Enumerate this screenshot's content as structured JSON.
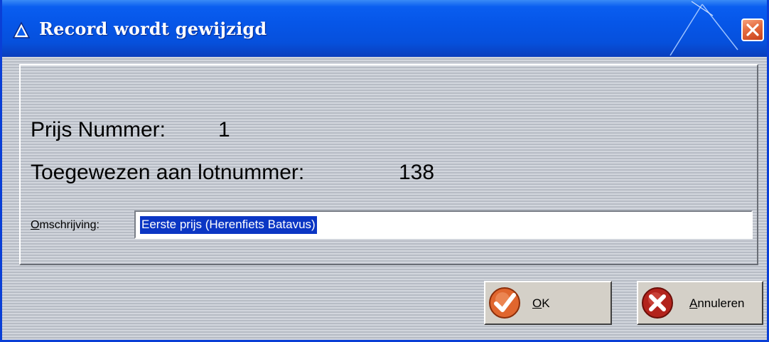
{
  "window": {
    "title": "Record wordt gewijzigd",
    "icon": "delta-app-icon",
    "close_icon": "close-icon",
    "accent": "#0656e8"
  },
  "record": {
    "prize_label": "Prijs Nummer:",
    "prize_value": "1",
    "assigned_label": "Toegewezen aan lotnummer:",
    "assigned_value": "138"
  },
  "form": {
    "description_label_underlined": "O",
    "description_label_rest": "mschrijving:",
    "description_value": "Eerste prijs (Herenfiets Batavus)"
  },
  "buttons": {
    "ok_underlined": "O",
    "ok_rest": "K",
    "ok_icon": "checkmark-icon",
    "cancel_underlined": "A",
    "cancel_rest": "nnuleren",
    "cancel_icon": "cancel-x-icon"
  }
}
